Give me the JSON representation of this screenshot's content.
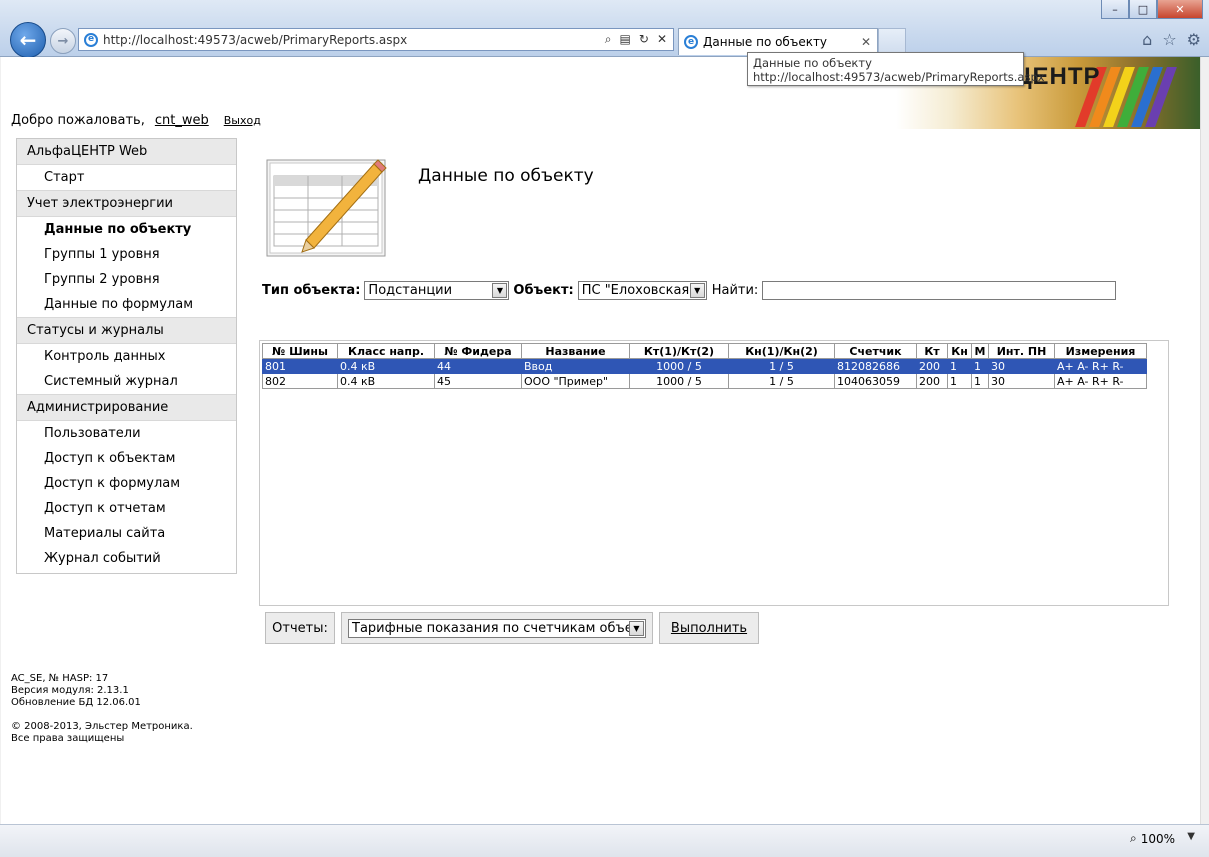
{
  "browser": {
    "url": "http://localhost:49573/acweb/PrimaryReports.aspx",
    "tab_title": "Данные по объекту",
    "tooltip_title": "Данные по объекту",
    "tooltip_url": "http://localhost:49573/acweb/PrimaryReports.aspx",
    "zoom": "100%",
    "window_minimize": "–",
    "window_maximize": "□",
    "window_close": "✕"
  },
  "header": {
    "brand": "ЦЕНТР",
    "welcome_text": "Добро пожаловать,",
    "username": "cnt_web",
    "logout": "Выход"
  },
  "sidebar": {
    "groups": [
      {
        "title": "АльфаЦЕНТР Web",
        "items": [
          "Старт"
        ]
      },
      {
        "title": "Учет электроэнергии",
        "items": [
          "Данные по объекту",
          "Группы 1 уровня",
          "Группы 2 уровня",
          "Данные по формулам"
        ]
      },
      {
        "title": "Статусы и журналы",
        "items": [
          "Контроль данных",
          "Системный журнал"
        ]
      },
      {
        "title": "Администрирование",
        "items": [
          "Пользователи",
          "Доступ к объектам",
          "Доступ к формулам",
          "Доступ к отчетам",
          "Материалы сайта",
          "Журнал событий"
        ]
      }
    ],
    "active_item": "Данные по объекту"
  },
  "footer": {
    "line1": "AC_SE, № HASP: 17",
    "line2": "Версия модуля: 2.13.1",
    "line3": "Обновление БД 12.06.01",
    "line4": "© 2008-2013, Эльстер Метроника.",
    "line5": "Все права защищены"
  },
  "main": {
    "title": "Данные по объекту",
    "filters": {
      "type_label": "Тип объекта:",
      "type_value": "Подстанции",
      "object_label": "Объект:",
      "object_value": "ПС \"Елоховская\"",
      "find_label": "Найти:",
      "find_value": ""
    },
    "table": {
      "columns": [
        "№ Шины",
        "Класс напр.",
        "№ Фидера",
        "Название",
        "Кт(1)/Кт(2)",
        "Кн(1)/Кн(2)",
        "Счетчик",
        "Кт",
        "Кн",
        "М",
        "Инт. ПН",
        "Измерения"
      ],
      "rows": [
        [
          "801",
          "0.4 кВ",
          "44",
          "Ввод",
          "1000 / 5",
          "1 / 5",
          "812082686",
          "200",
          "1",
          "1",
          "30",
          "A+ A- R+ R-"
        ],
        [
          "802",
          "0.4 кВ",
          "45",
          "ООО \"Пример\"",
          "1000 / 5",
          "1 / 5",
          "104063059",
          "200",
          "1",
          "1",
          "30",
          "A+ A- R+ R-"
        ]
      ],
      "selected_row": 0
    },
    "reports_label": "Отчеты:",
    "report_value": "Тарифные показания по счетчикам объекта",
    "run_button": "Выполнить"
  },
  "colors": {
    "selection": "#2f56b5",
    "sidebar_group_bg": "#e9e9e9"
  }
}
